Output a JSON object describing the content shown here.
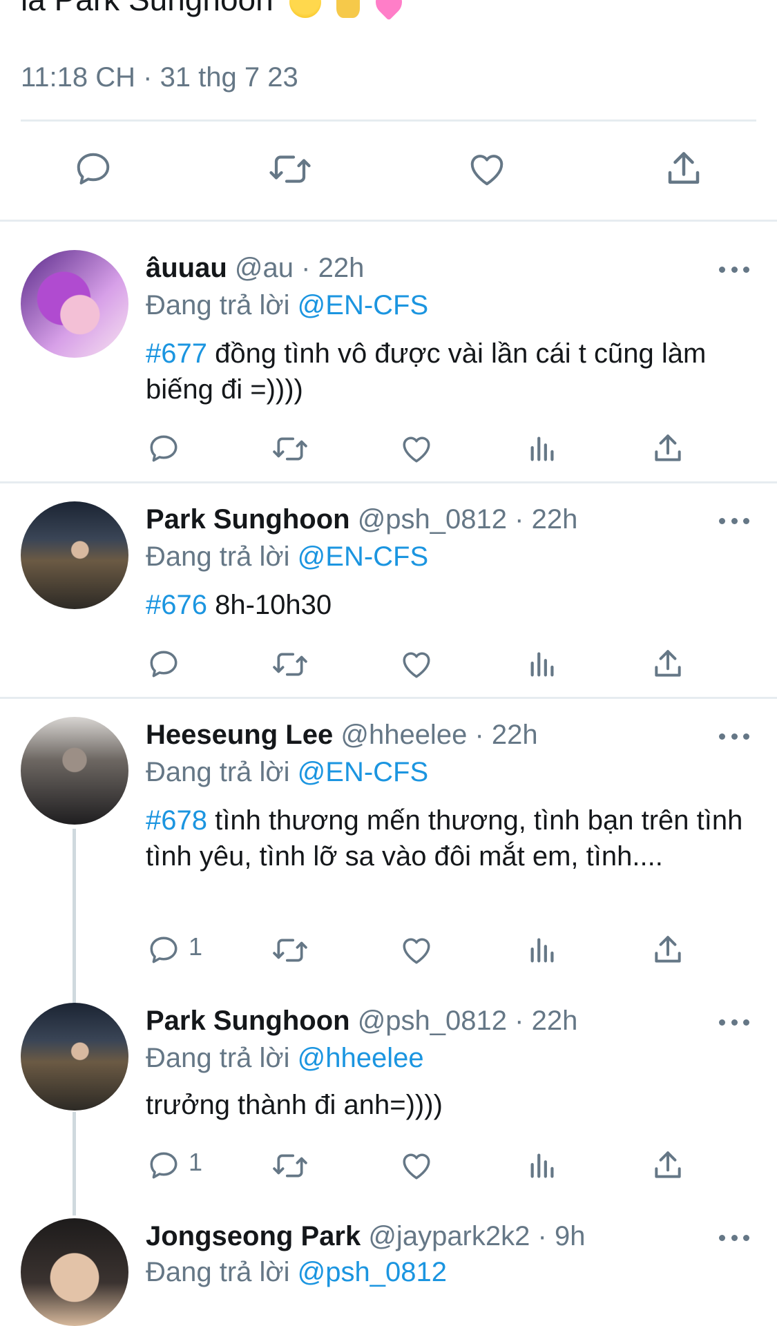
{
  "tweet_text_fragment": "là Park Sunghoon",
  "timestamp": "11:18 CH · 31 thg 7 23",
  "colors": {
    "accent": "#1b95e0",
    "muted": "#657786",
    "divider": "#e6ecf0"
  },
  "replies": [
    {
      "name": "âuuau",
      "handle": "@au",
      "time": "22h",
      "reply_prefix": "Đang trả lời",
      "reply_to": "@EN-CFS",
      "tag": "#677",
      "text": "đồng tình vô được vài lần cái t cũng làm biếng đi =))))",
      "reply_count": ""
    },
    {
      "name": "Park Sunghoon",
      "handle": "@psh_0812",
      "time": "22h",
      "reply_prefix": "Đang trả lời",
      "reply_to": "@EN-CFS",
      "tag": "#676",
      "text": "8h-10h30",
      "reply_count": ""
    },
    {
      "name": "Heeseung Lee",
      "handle": "@hheelee",
      "time": "22h",
      "reply_prefix": "Đang trả lời",
      "reply_to": "@EN-CFS",
      "tag": "#678",
      "text": "tình thương mến thương, tình bạn trên tình tình yêu, tình lỡ sa vào đôi mắt em, tình....",
      "reply_count": "1"
    },
    {
      "name": "Park Sunghoon",
      "handle": "@psh_0812",
      "time": "22h",
      "reply_prefix": "Đang trả lời",
      "reply_to": "@hheelee",
      "tag": "",
      "text": "trưởng thành đi anh=))))",
      "reply_count": "1"
    },
    {
      "name": "Jongseong Park",
      "handle": "@jaypark2k2",
      "time": "9h",
      "reply_prefix": "Đang trả lời",
      "reply_to": "@psh_0812",
      "tag": "",
      "text": "",
      "reply_count": ""
    }
  ],
  "separator": "·",
  "icons": [
    "reply-icon",
    "retweet-icon",
    "like-icon",
    "analytics-icon",
    "share-icon",
    "more-icon"
  ]
}
